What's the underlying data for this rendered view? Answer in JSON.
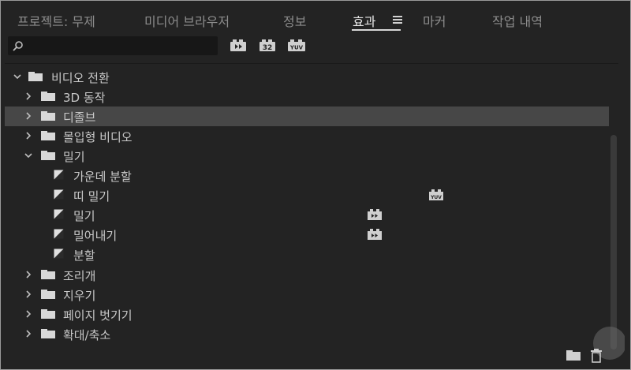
{
  "tabs": [
    {
      "label": "프로젝트: 무제"
    },
    {
      "label": "미디어 브라우저"
    },
    {
      "label": "정보"
    },
    {
      "label": "효과"
    },
    {
      "label": "마커"
    },
    {
      "label": "작업 내역"
    }
  ],
  "active_tab": "효과",
  "search": {
    "value": "",
    "placeholder": ""
  },
  "toolbar": {
    "accelerated_icon": "accelerated-effects-icon",
    "bit32_label": "32",
    "yuv_label": "YUV"
  },
  "tree": {
    "root": "비디오 전환",
    "folders": [
      {
        "label": "3D 동작",
        "expanded": false
      },
      {
        "label": "디졸브",
        "expanded": false,
        "selected": true
      },
      {
        "label": "몰입형 비디오",
        "expanded": false
      },
      {
        "label": "밀기",
        "expanded": true,
        "items": [
          {
            "label": "가운데 분할",
            "badge": ""
          },
          {
            "label": "띠 밀기",
            "badge": "YUV"
          },
          {
            "label": "밀기",
            "badge": "accelerated"
          },
          {
            "label": "밀어내기",
            "badge": "accelerated"
          },
          {
            "label": "분할",
            "badge": ""
          }
        ]
      },
      {
        "label": "조리개",
        "expanded": false
      },
      {
        "label": "지우기",
        "expanded": false
      },
      {
        "label": "페이지 벗기기",
        "expanded": false
      },
      {
        "label": "확대/축소",
        "expanded": false
      }
    ]
  },
  "colors": {
    "background": "#232323",
    "selection": "#474747",
    "text": "#c8c8c8",
    "tab_inactive": "#8c8c8c"
  }
}
